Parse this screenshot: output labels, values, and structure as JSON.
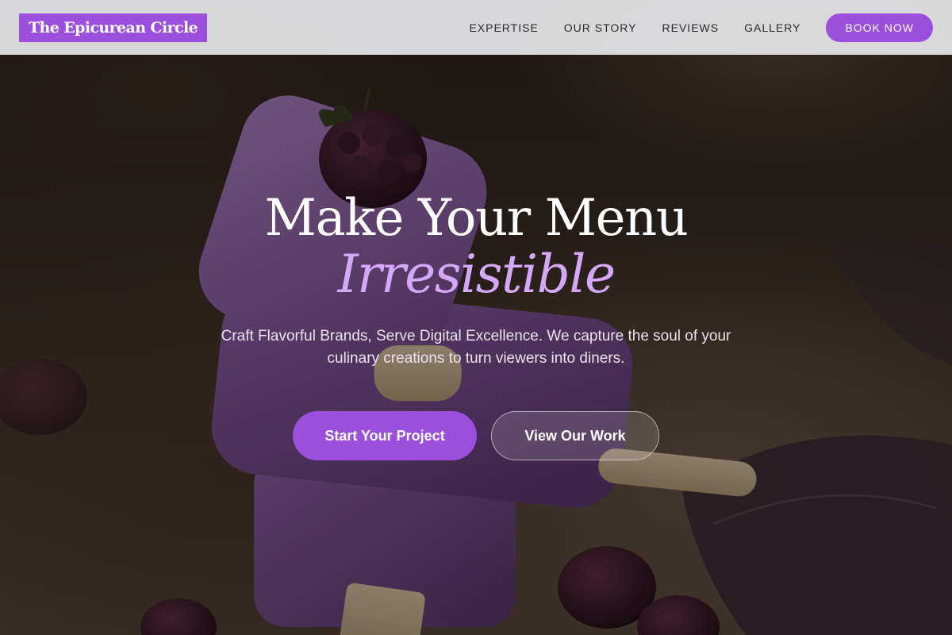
{
  "nav": {
    "brand": "The Epicurean Circle",
    "links": [
      "EXPERTISE",
      "OUR STORY",
      "REVIEWS",
      "GALLERY"
    ],
    "cta": "BOOK NOW"
  },
  "hero": {
    "headline": "Make Your Menu",
    "headline_accent": "Irresistible",
    "subtitle": "Craft Flavorful Brands, Serve Digital Excellence. We capture the soul of your culinary creations to turn viewers into diners.",
    "primary_button": "Start Your Project",
    "secondary_button": "View Our Work",
    "background_image": "purple-popsicles-with-blackberries"
  },
  "colors": {
    "accent": "#9b4fdc",
    "accent_light": "#d4a7f7",
    "nav_bg": "#e8e8ea"
  }
}
